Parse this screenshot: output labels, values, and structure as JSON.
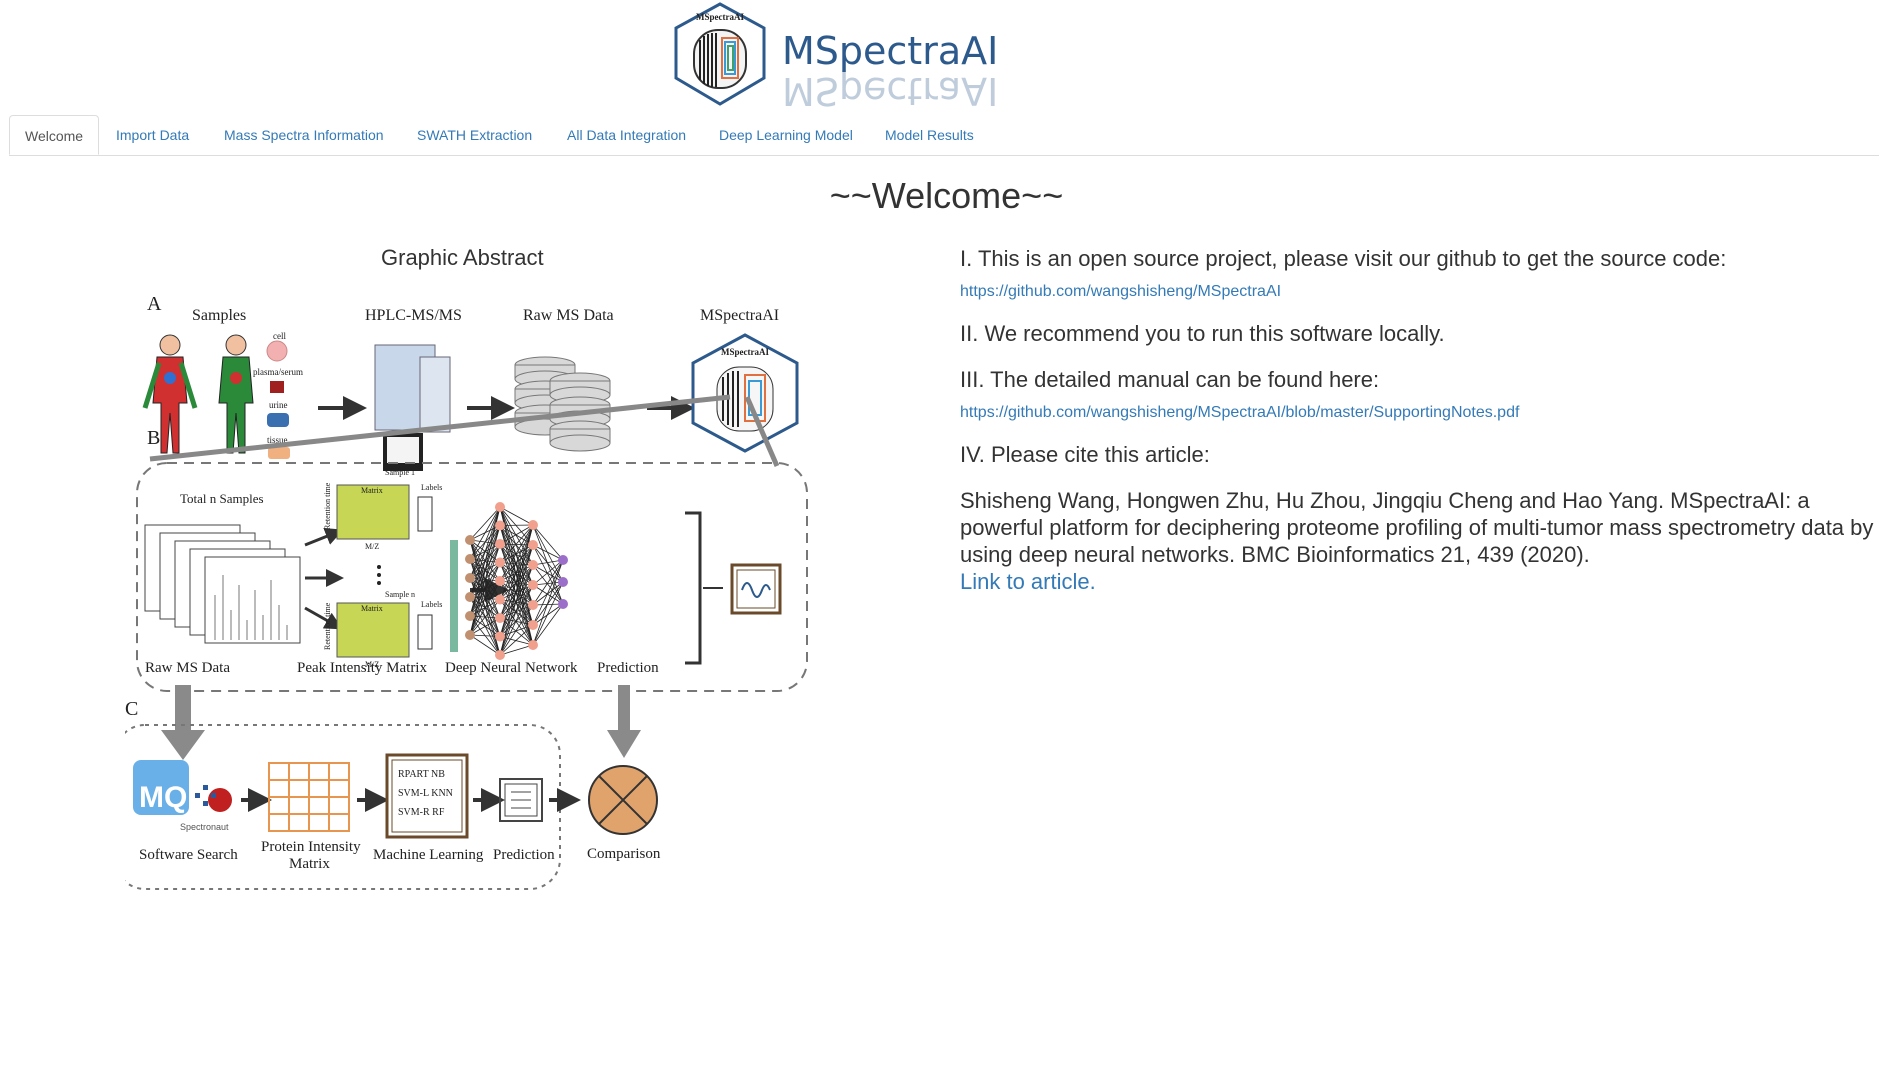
{
  "app": {
    "logo_text": "MSpectraAI",
    "logo_badge": "MSpectraAI"
  },
  "tabs": [
    {
      "label": "Welcome",
      "active": true
    },
    {
      "label": "Import Data",
      "active": false
    },
    {
      "label": "Mass Spectra Information",
      "active": false
    },
    {
      "label": "SWATH Extraction",
      "active": false
    },
    {
      "label": "All Data Integration",
      "active": false
    },
    {
      "label": "Deep Learning Model",
      "active": false
    },
    {
      "label": "Model Results",
      "active": false
    }
  ],
  "welcome": {
    "title": "~~Welcome~~"
  },
  "graphic_abstract": {
    "title": "Graphic Abstract",
    "panel_a": {
      "letter": "A",
      "samples": "Samples",
      "sample_types": [
        "cell",
        "plasma/serum",
        "urine",
        "tissue"
      ],
      "hplc": "HPLC-MS/MS",
      "raw_ms": "Raw MS Data",
      "mspectraai": "MSpectraAI"
    },
    "panel_b": {
      "letter": "B",
      "total_samples": "Total n Samples",
      "sample1": "Sample 1",
      "samplen": "Sample n",
      "matrix": "Matrix",
      "labels": "Labels",
      "retention_time": "Retention time",
      "mz": "M/Z",
      "raw_ms": "Raw MS Data",
      "peak_matrix": "Peak Intensity Matrix",
      "dnn": "Deep Neural Network",
      "prediction": "Prediction"
    },
    "panel_c": {
      "letter": "C",
      "software_search": "Software Search",
      "spectronaut": "Spectronaut",
      "mq": "MQ",
      "protein_matrix_line1": "Protein Intensity",
      "protein_matrix_line2": "Matrix",
      "ml_methods": [
        "RPART  NB",
        "SVM-L  KNN",
        "SVM-R   RF"
      ],
      "machine_learning": "Machine Learning",
      "prediction": "Prediction",
      "comparison": "Comparison"
    }
  },
  "info": {
    "item1": "I. This is an open source project, please visit our github to get the source code:",
    "link1": "https://github.com/wangshisheng/MSpectraAI",
    "item2": "II. We recommend you to run this software locally.",
    "item3": "III. The detailed manual can be found here:",
    "link2": "https://github.com/wangshisheng/MSpectraAI/blob/master/SupportingNotes.pdf",
    "item4": "IV. Please cite this article:",
    "citation": "Shisheng Wang, Hongwen Zhu, Hu Zhou, Jingqiu Cheng and Hao Yang. MSpectraAI: a powerful platform for deciphering proteome profiling of multi-tumor mass spectrometry data by using deep neural networks. BMC Bioinformatics 21, 439 (2020).",
    "article_link": "Link to article."
  },
  "colors": {
    "link": "#337ab7",
    "tab_border": "#dddddd",
    "arrow_gray": "#8a8a8a",
    "matrix_green": "#c8d655",
    "grid_orange": "#e8954f",
    "node_tan": "#c09070",
    "node_pink": "#f0a08c",
    "node_purple": "#9b6fc9",
    "comparison_fill": "#e0a36c"
  }
}
